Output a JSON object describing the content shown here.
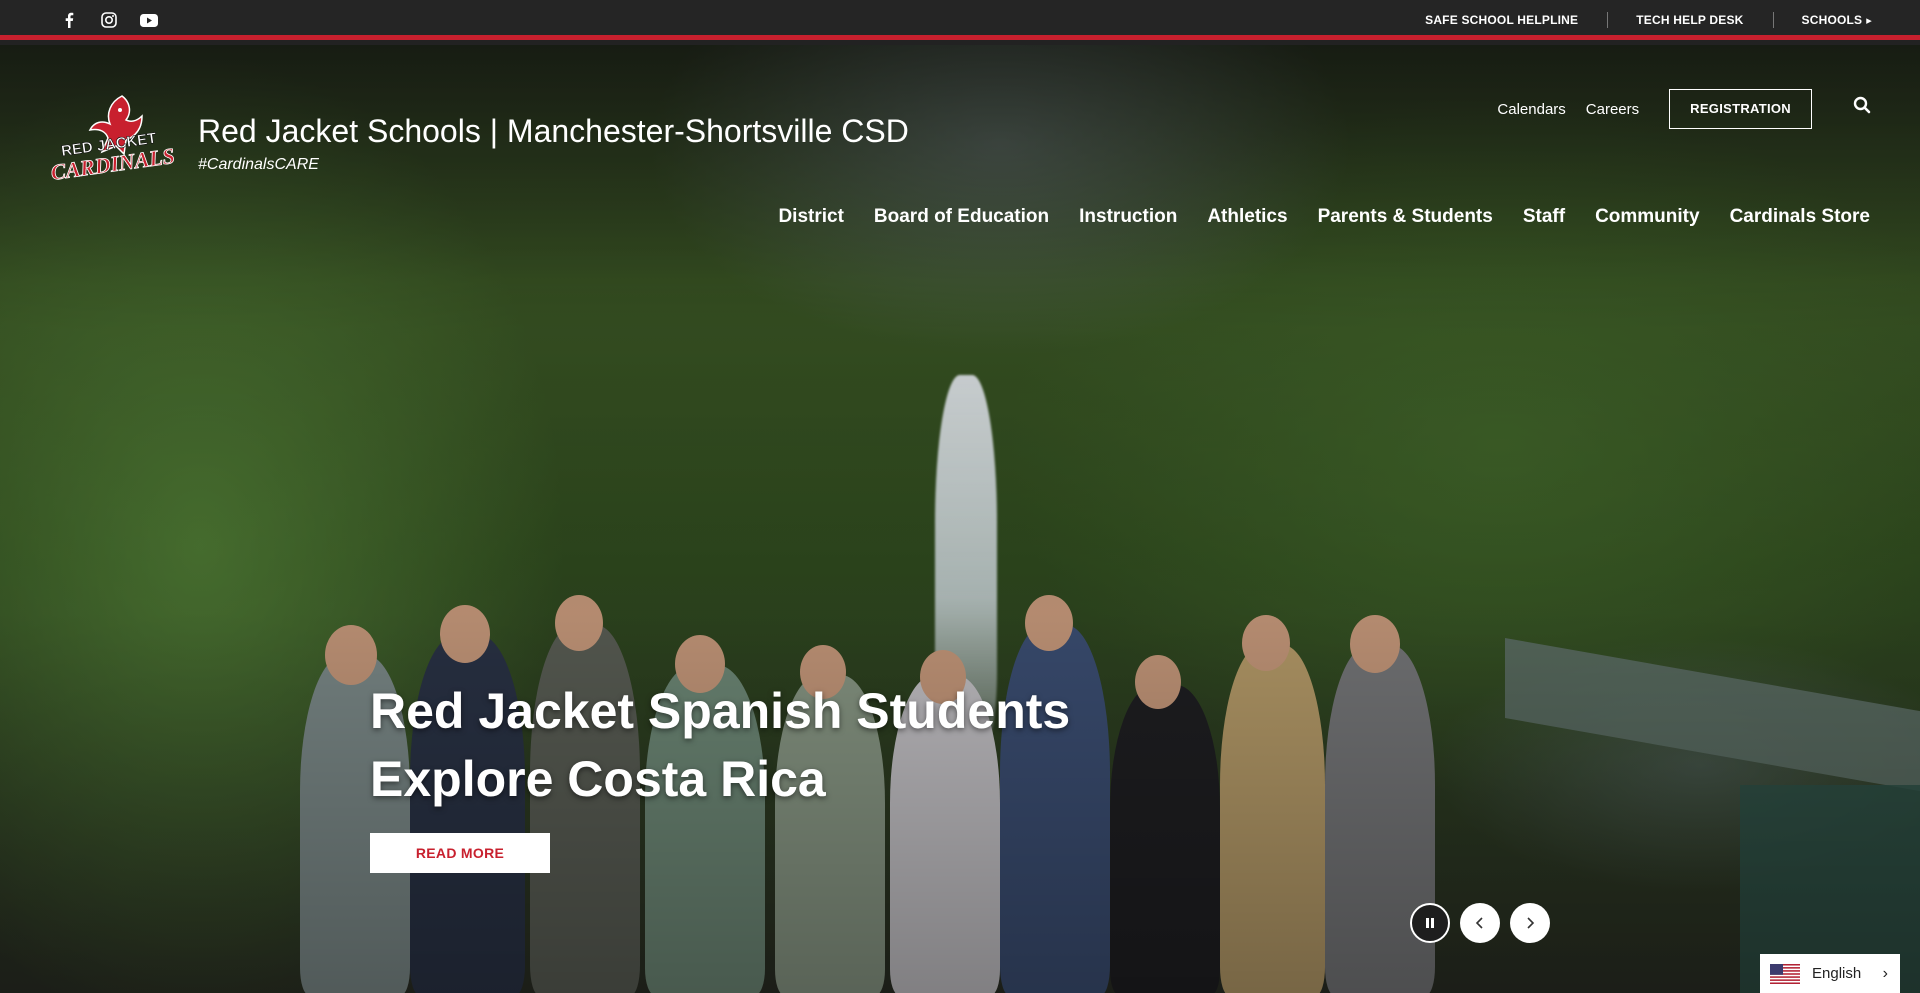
{
  "topbar": {
    "social": [
      "facebook-icon",
      "instagram-icon",
      "youtube-icon"
    ],
    "links": [
      "SAFE SCHOOL HELPLINE",
      "TECH HELP DESK",
      "SCHOOLS"
    ],
    "accent": "#c8202e"
  },
  "header": {
    "title": "Red Jacket Schools | Manchester-Shortsville CSD",
    "tagline": "#CardinalsCARE",
    "logo_text_top": "RED JACKET",
    "logo_text_bottom": "CARDINALS",
    "quick_links": [
      "Calendars",
      "Careers"
    ],
    "registration_label": "REGISTRATION"
  },
  "nav": {
    "items": [
      "District",
      "Board of Education",
      "Instruction",
      "Athletics",
      "Parents & Students",
      "Staff",
      "Community",
      "Cardinals Store"
    ]
  },
  "slide": {
    "title": "Red Jacket Spanish Students Explore Costa Rica",
    "button": "READ MORE"
  },
  "language": {
    "label": "English"
  }
}
